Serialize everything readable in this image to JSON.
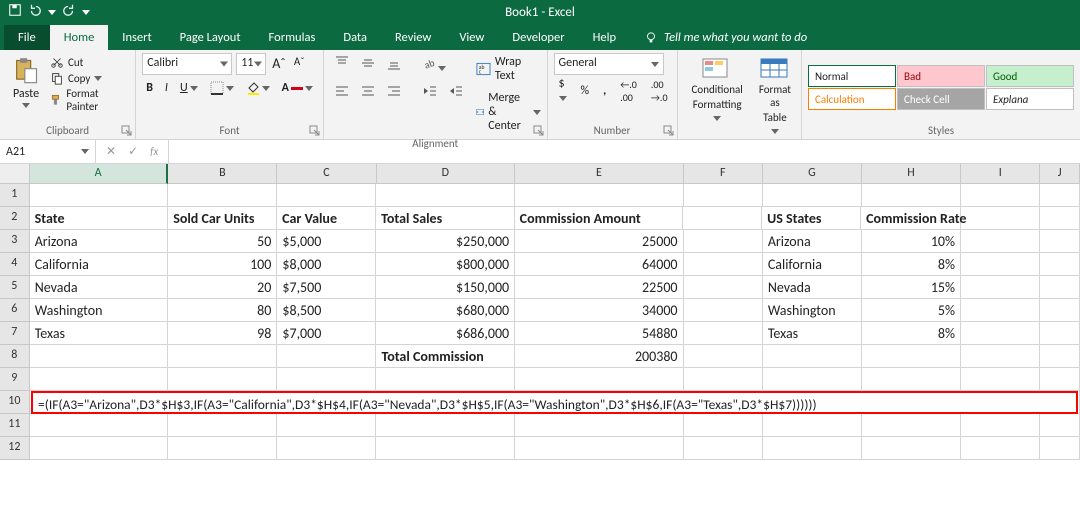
{
  "titlebar": {
    "title": "Book1 - Excel"
  },
  "tabs": [
    "File",
    "Home",
    "Insert",
    "Page Layout",
    "Formulas",
    "Data",
    "Review",
    "View",
    "Developer",
    "Help"
  ],
  "tellme": "Tell me what you want to do",
  "clipboard": {
    "paste": "Paste",
    "cut": "Cut",
    "copy": "Copy",
    "painter": "Format Painter",
    "label": "Clipboard"
  },
  "font": {
    "name": "Calibri",
    "size": "11",
    "label": "Font"
  },
  "alignment": {
    "wrap": "Wrap Text",
    "merge": "Merge & Center",
    "label": "Alignment"
  },
  "number": {
    "format": "General",
    "label": "Number"
  },
  "cond": {
    "line1": "Conditional",
    "line2": "Formatting"
  },
  "fmt": {
    "line1": "Format as",
    "line2": "Table"
  },
  "styles": {
    "normal": "Normal",
    "bad": "Bad",
    "good": "Good",
    "calc": "Calculation",
    "check": "Check Cell",
    "expl": "Explana",
    "label": "Styles"
  },
  "namebox": "A21",
  "cols": [
    "A",
    "B",
    "C",
    "D",
    "E",
    "F",
    "G",
    "H",
    "I",
    "J"
  ],
  "colW": [
    "wA",
    "wB",
    "wC",
    "wD",
    "wE",
    "wF",
    "wG",
    "wH",
    "wI",
    "wJ"
  ],
  "rows": [
    "1",
    "2",
    "3",
    "4",
    "5",
    "6",
    "7",
    "8",
    "9",
    "10",
    "11",
    "12"
  ],
  "headers": {
    "A2": "State",
    "B2": "Sold Car Units",
    "C2": "Car Value",
    "D2": "Total Sales",
    "E2": "Commission Amount",
    "G2": "US States",
    "H2": "Commission Rate"
  },
  "data": {
    "main": [
      {
        "state": "Arizona",
        "units": "50",
        "value": "$5,000",
        "sales": "$250,000",
        "comm": "25000"
      },
      {
        "state": "California",
        "units": "100",
        "value": "$8,000",
        "sales": "$800,000",
        "comm": "64000"
      },
      {
        "state": "Nevada",
        "units": "20",
        "value": "$7,500",
        "sales": "$150,000",
        "comm": "22500"
      },
      {
        "state": "Washington",
        "units": "80",
        "value": "$8,500",
        "sales": "$680,000",
        "comm": "34000"
      },
      {
        "state": "Texas",
        "units": "98",
        "value": "$7,000",
        "sales": "$686,000",
        "comm": "54880"
      }
    ],
    "lookup": [
      {
        "state": "Arizona",
        "rate": "10%"
      },
      {
        "state": "California",
        "rate": "8%"
      },
      {
        "state": "Nevada",
        "rate": "15%"
      },
      {
        "state": "Washington",
        "rate": "5%"
      },
      {
        "state": "Texas",
        "rate": "8%"
      }
    ],
    "total_label": "Total Commission",
    "total_value": "200380"
  },
  "formula": "=(IF(A3=\"Arizona\",D3*$H$3,IF(A3=\"California\",D3*$H$4,IF(A3=\"Nevada\",D3*$H$5,IF(A3=\"Washington\",D3*$H$6,IF(A3=\"Texas\",D3*$H$7))))))"
}
